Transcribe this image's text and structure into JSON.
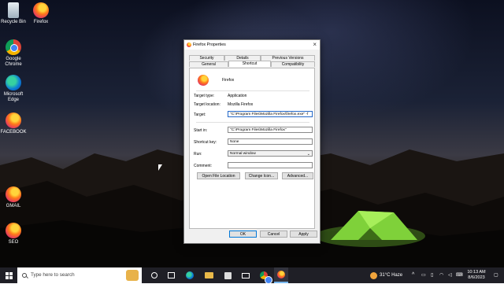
{
  "desktop": {
    "icons": [
      {
        "label": "Recycle Bin"
      },
      {
        "label": "Firefox"
      },
      {
        "label": "Google Chrome"
      },
      {
        "label": "Microsoft Edge"
      },
      {
        "label": "FACEBOOK"
      },
      {
        "label": "GMAIL"
      },
      {
        "label": "SEO"
      }
    ]
  },
  "dialog": {
    "title": "Firefox Properties",
    "tabs_row1": [
      "Security",
      "Details",
      "Previous Versions"
    ],
    "tabs_row2": [
      "General",
      "Shortcut",
      "Compatibility"
    ],
    "selected_tab": "Shortcut",
    "app_name": "Firefox",
    "target_type_label": "Target type:",
    "target_type_value": "Application",
    "target_location_label": "Target location:",
    "target_location_value": "Mozilla Firefox",
    "target_label": "Target:",
    "target_value": "\"C:\\Program Files\\Mozilla Firefox\\firefox.exe\" -f",
    "start_in_label": "Start in:",
    "start_in_value": "\"C:\\Program Files\\Mozilla Firefox\"",
    "shortcut_key_label": "Shortcut key:",
    "shortcut_key_value": "None",
    "run_label": "Run:",
    "run_value": "Normal window",
    "comment_label": "Comment:",
    "comment_value": "",
    "open_file_location": "Open File Location",
    "change_icon": "Change Icon...",
    "advanced": "Advanced...",
    "ok": "OK",
    "cancel": "Cancel",
    "apply": "Apply"
  },
  "taskbar": {
    "search_placeholder": "Type here to search",
    "weather": "31°C  Haze",
    "time": "10:13 AM",
    "date": "8/6/2023"
  },
  "colors": {
    "accent": "#0078d7",
    "taskbar": "#1f1f26",
    "tent": "#7fd13a"
  }
}
